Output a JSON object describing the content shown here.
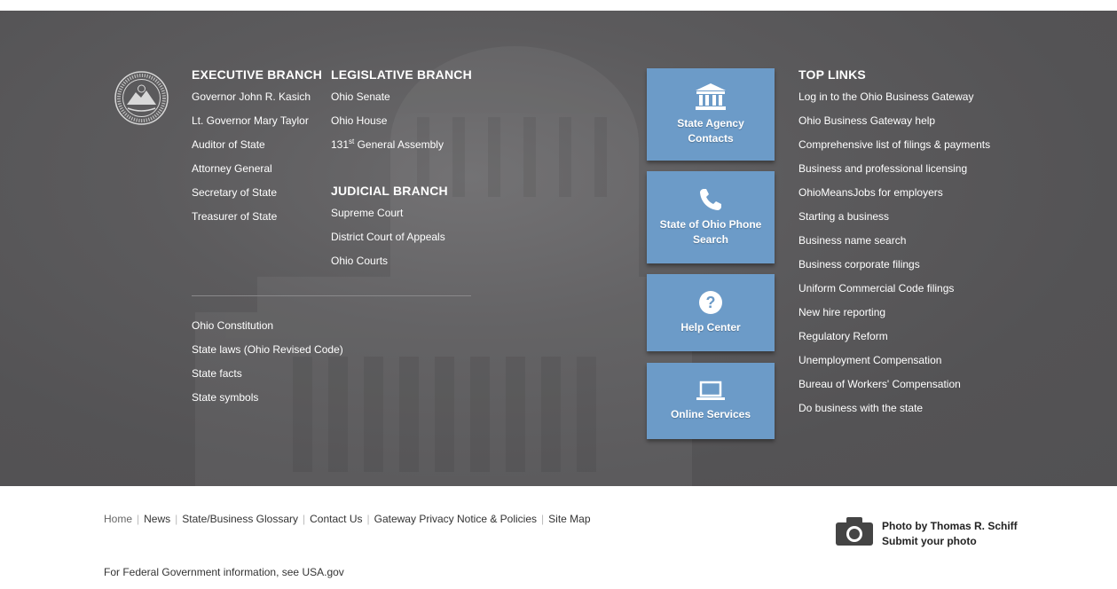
{
  "executive": {
    "heading": "EXECUTIVE BRANCH",
    "links": [
      "Governor John R. Kasich",
      "Lt. Governor Mary Taylor",
      "Auditor of State",
      "Attorney General",
      "Secretary of State",
      "Treasurer of State"
    ]
  },
  "legislative": {
    "heading": "LEGISLATIVE BRANCH",
    "links": [
      "Ohio Senate",
      "Ohio House"
    ],
    "assembly": {
      "number": "131",
      "suffix": "st",
      "rest": " General Assembly"
    }
  },
  "judicial": {
    "heading": "JUDICIAL BRANCH",
    "links": [
      "Supreme Court",
      "District Court of Appeals",
      "Ohio Courts"
    ]
  },
  "misc_links": [
    "Ohio Constitution",
    "State laws (Ohio Revised Code)",
    "State facts",
    "State symbols"
  ],
  "tiles": [
    {
      "label": "State Agency Contacts",
      "icon": "government-building-icon"
    },
    {
      "label": "State of Ohio Phone Search",
      "icon": "phone-icon"
    },
    {
      "label": "Help Center",
      "icon": "question-icon"
    },
    {
      "label": "Online Services",
      "icon": "laptop-icon"
    }
  ],
  "top_links": {
    "heading": "TOP LINKS",
    "links": [
      "Log in to the Ohio Business Gateway",
      "Ohio Business Gateway help",
      "Comprehensive list of filings & payments",
      "Business and professional licensing",
      "OhioMeansJobs for employers",
      "Starting a business",
      "Business name search",
      "Business corporate filings",
      "Uniform Commercial Code filings",
      "New hire reporting",
      "Regulatory Reform",
      "Unemployment Compensation",
      "Bureau of Workers' Compensation",
      "Do business with the state"
    ]
  },
  "bottom_nav": [
    "Home",
    "News",
    "State/Business Glossary",
    "Contact Us",
    "Gateway Privacy Notice & Policies",
    "Site Map"
  ],
  "federal": {
    "prefix": "For Federal Government information, see ",
    "link": "USA.gov"
  },
  "photo": {
    "credit": "Photo by Thomas R. Schiff",
    "submit": "Submit your photo"
  },
  "colors": {
    "dark_bg": "#555456",
    "tile_bg": "#6c9bc8",
    "text_light": "#ffffff"
  }
}
